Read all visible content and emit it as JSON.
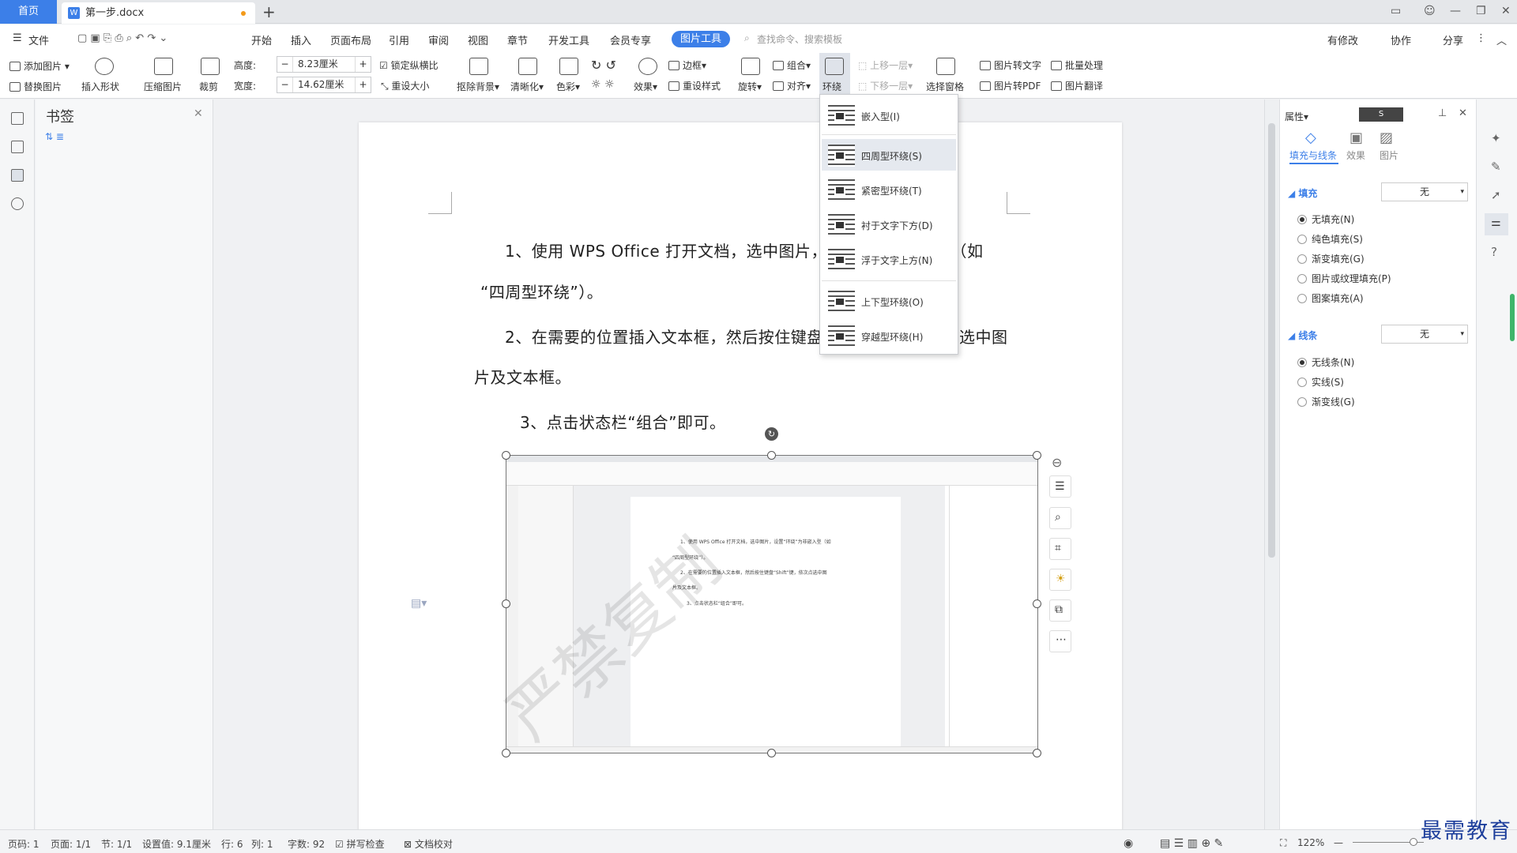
{
  "tabs": {
    "home": "首页",
    "doc": "第一步.docx"
  },
  "menu": {
    "file": "文件",
    "items": [
      "开始",
      "插入",
      "页面布局",
      "引用",
      "审阅",
      "视图",
      "章节",
      "开发工具",
      "会员专享"
    ],
    "active": "图片工具",
    "search": "查找命令、搜索模板",
    "right": [
      "有修改",
      "协作",
      "分享"
    ]
  },
  "ribbon": {
    "add_pic": "添加图片",
    "replace_pic": "替换图片",
    "insert_shape": "插入形状",
    "compress": "压缩图片",
    "crop": "裁剪",
    "height_label": "高度:",
    "height_value": "8.23厘米",
    "width_label": "宽度:",
    "width_value": "14.62厘米",
    "lock_ratio": "锁定纵横比",
    "reset_size": "重设大小",
    "remove_bg": "抠除背景",
    "sharpen": "清晰化",
    "color": "色彩",
    "effect": "效果",
    "border": "边框",
    "reset_style": "重设样式",
    "rotate": "旋转",
    "group": "组合",
    "align": "对齐",
    "wrap": "环绕",
    "bring_forward": "上移一层",
    "send_backward": "下移一层",
    "selection_pane": "选择窗格",
    "pic_to_text": "图片转文字",
    "batch": "批量处理",
    "pic_to_pdf": "图片转PDF",
    "pic_translate": "图片翻译"
  },
  "bookmarks": {
    "title": "书签"
  },
  "doc": {
    "p1a": "1、使用 WPS Office 打开文档，选中图片，设",
    "p1b": "型（如",
    "p1c": "“四周型环绕”）。",
    "p2a": "2、在需要的位置插入文本框，然后按住键盘“",
    "p2b": "选中图",
    "p2c": "片及文本框。",
    "p3": "3、点击状态栏“组合”即可。",
    "watermark": "严禁复制"
  },
  "thumb": {
    "l1": "1、使用 WPS Office 打开文档，选中图片，设置“环绕”为非嵌入型（如",
    "l2": "“四周型环绕”）。",
    "l3": "2、在需要的位置插入文本框，然后按住键盘“Shift”键，依次点选中图",
    "l4": "片及文本框。",
    "l5": "3、点击状态栏“组合”即可。"
  },
  "wrap_menu": [
    {
      "label": "嵌入型(I)"
    },
    {
      "label": "四周型环绕(S)"
    },
    {
      "label": "紧密型环绕(T)"
    },
    {
      "label": "衬于文字下方(D)"
    },
    {
      "label": "浮于文字上方(N)"
    },
    {
      "label": "上下型环绕(O)"
    },
    {
      "label": "穿越型环绕(H)"
    }
  ],
  "panel": {
    "title": "属性",
    "tabs": [
      "填充与线条",
      "效果",
      "图片"
    ],
    "fill": {
      "title": "填充",
      "value": "无",
      "options": [
        "无填充(N)",
        "纯色填充(S)",
        "渐变填充(G)",
        "图片或纹理填充(P)",
        "图案填充(A)"
      ]
    },
    "line": {
      "title": "线条",
      "value": "无",
      "options": [
        "无线条(N)",
        "实线(S)",
        "渐变线(G)"
      ]
    }
  },
  "status": {
    "page_no": "页码: 1",
    "pages": "页面: 1/1",
    "section": "节: 1/1",
    "setting": "设置值: 9.1厘米",
    "row": "行: 6",
    "col": "列: 1",
    "words": "字数: 92",
    "spell": "拼写检查",
    "proof": "文档校对",
    "zoom": "122%"
  },
  "brand": "最需教育",
  "colors": {
    "accent": "#3c7fe8",
    "brand": "#1e3f9c"
  }
}
